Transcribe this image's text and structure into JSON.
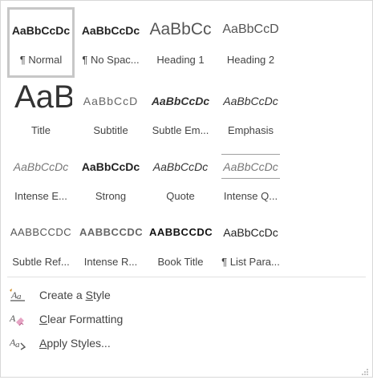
{
  "styles_gallery": {
    "items": [
      {
        "sample": "AaBbCcDc",
        "name": "¶ Normal",
        "selected": true
      },
      {
        "sample": "AaBbCcDc",
        "name": "¶ No Spac..."
      },
      {
        "sample": "AaBbCc",
        "name": "Heading 1"
      },
      {
        "sample": "AaBbCcD",
        "name": "Heading 2"
      },
      {
        "sample": "AaBl",
        "name": "Title"
      },
      {
        "sample": "AaBbCcD",
        "name": "Subtitle"
      },
      {
        "sample": "AaBbCcDc",
        "name": "Subtle Em..."
      },
      {
        "sample": "AaBbCcDc",
        "name": "Emphasis"
      },
      {
        "sample": "AaBbCcDc",
        "name": "Intense E..."
      },
      {
        "sample": "AaBbCcDc",
        "name": "Strong"
      },
      {
        "sample": "AaBbCcDc",
        "name": "Quote"
      },
      {
        "sample": "AaBbCcDc",
        "name": "Intense Q..."
      },
      {
        "sample": "AABBCCDC",
        "name": "Subtle Ref..."
      },
      {
        "sample": "AABBCCDC",
        "name": "Intense R..."
      },
      {
        "sample": "AABBCCDC",
        "name": "Book Title"
      },
      {
        "sample": "AaBbCcDc",
        "name": "¶ List Para..."
      }
    ]
  },
  "menu": {
    "create_style": {
      "pre": "Create a ",
      "key": "S",
      "post": "tyle",
      "icon": "create-style-icon"
    },
    "clear_formatting": {
      "pre": "",
      "key": "C",
      "post": "lear Formatting",
      "icon": "clear-formatting-icon"
    },
    "apply_styles": {
      "pre": "",
      "key": "A",
      "post": "pply Styles...",
      "icon": "apply-styles-icon"
    }
  },
  "colors": {
    "selected_border": "#c7c7c7",
    "text": "#444444"
  }
}
